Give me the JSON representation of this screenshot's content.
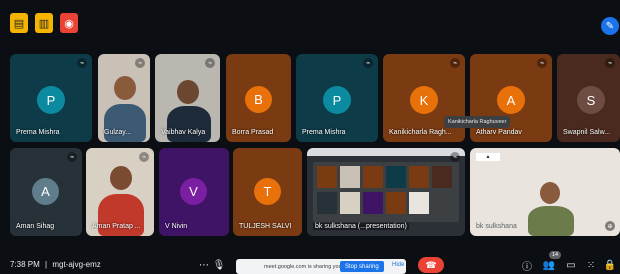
{
  "meeting": {
    "time": "7:38 PM",
    "separator": "|",
    "code": "mgt-ajvg-emz"
  },
  "sharing_banner": {
    "text": "meet.google.com is sharing your screen.",
    "stop_label": "Stop sharing",
    "hide_label": "Hide"
  },
  "tooltip": "Kanikicharla Raghuveer",
  "people_count": "14",
  "tiles": [
    {
      "name": "Prema Mishra",
      "initial": "P",
      "avatar_color": "#0b8aa0",
      "bg": "#0e3b48",
      "type": "avatar"
    },
    {
      "name": "Gulzay...",
      "initial": "",
      "bg": "#c9c1b5",
      "type": "video"
    },
    {
      "name": "Vaibhav Kalya",
      "initial": "",
      "bg": "#b9b7b0",
      "type": "video"
    },
    {
      "name": "Borra Prasad",
      "initial": "B",
      "avatar_color": "#e8710a",
      "bg": "#7a3a12",
      "type": "avatar"
    },
    {
      "name": "Prema Mishra",
      "initial": "P",
      "avatar_color": "#0b8aa0",
      "bg": "#0e3b48",
      "type": "avatar"
    },
    {
      "name": "Kanikicharla Ragh...",
      "initial": "K",
      "avatar_color": "#e8710a",
      "bg": "#7a3a12",
      "type": "avatar"
    },
    {
      "name": "Atharv Pandav",
      "initial": "A",
      "avatar_color": "#e8710a",
      "bg": "#7a3a12",
      "type": "avatar"
    },
    {
      "name": "Swapnil Salw...",
      "initial": "S",
      "avatar_color": "#6d4c41",
      "bg": "#4a2a1e",
      "type": "avatar"
    },
    {
      "name": "Aman Sihag",
      "initial": "A",
      "avatar_color": "#607d8b",
      "bg": "#263238",
      "type": "avatar"
    },
    {
      "name": "Aman Pratap ...",
      "initial": "",
      "bg": "#d9d0c4",
      "type": "video"
    },
    {
      "name": "V Nivin",
      "initial": "V",
      "avatar_color": "#7b1fa2",
      "bg": "#3f1365",
      "type": "avatar"
    },
    {
      "name": "TULJESH SALVI",
      "initial": "T",
      "avatar_color": "#e8710a",
      "bg": "#7a3a12",
      "type": "avatar"
    },
    {
      "name": "bk sulkshana (...presentation)",
      "initial": "",
      "bg": "#2b2f36",
      "type": "screen"
    },
    {
      "name": "bk sulkshana",
      "initial": "",
      "bg": "#e9e4de",
      "type": "video"
    }
  ],
  "icons": {
    "top": [
      "files-icon",
      "notes-icon",
      "record-icon"
    ],
    "edit": "pencil-icon",
    "bottom": [
      "more-icon",
      "mic-icon",
      "info-icon",
      "people-icon",
      "chat-icon",
      "activities-icon",
      "lock-icon"
    ]
  },
  "colors": {
    "background": "#0b0f14",
    "accent": "#1a73e8",
    "end_call": "#ea4335",
    "top_btn_yellow": "#f4b400",
    "top_btn_red": "#ea4335"
  }
}
